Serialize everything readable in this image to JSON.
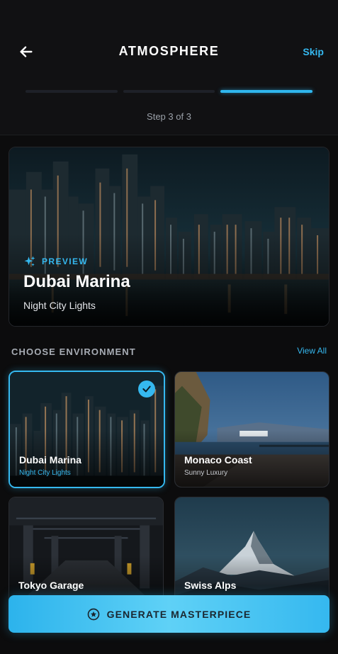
{
  "header": {
    "title": "ATMOSPHERE",
    "skip_label": "Skip",
    "step_text": "Step 3 of 3",
    "progress": {
      "current_step": 3,
      "total_steps": 3
    }
  },
  "preview": {
    "tag": "PREVIEW",
    "title": "Dubai Marina",
    "subtitle": "Night City Lights"
  },
  "environments": {
    "section_title": "CHOOSE ENVIRONMENT",
    "view_all_label": "View All",
    "items": [
      {
        "name": "Dubai Marina",
        "subtitle": "Night City Lights",
        "selected": true
      },
      {
        "name": "Monaco Coast",
        "subtitle": "Sunny Luxury",
        "selected": false
      },
      {
        "name": "Tokyo Garage",
        "subtitle": "",
        "selected": false
      },
      {
        "name": "Swiss Alps",
        "subtitle": "",
        "selected": false
      }
    ]
  },
  "cta": {
    "label": "GENERATE MASTERPIECE"
  },
  "colors": {
    "accent": "#35b8ef",
    "background": "#0c0c0d",
    "header": "#111113"
  }
}
